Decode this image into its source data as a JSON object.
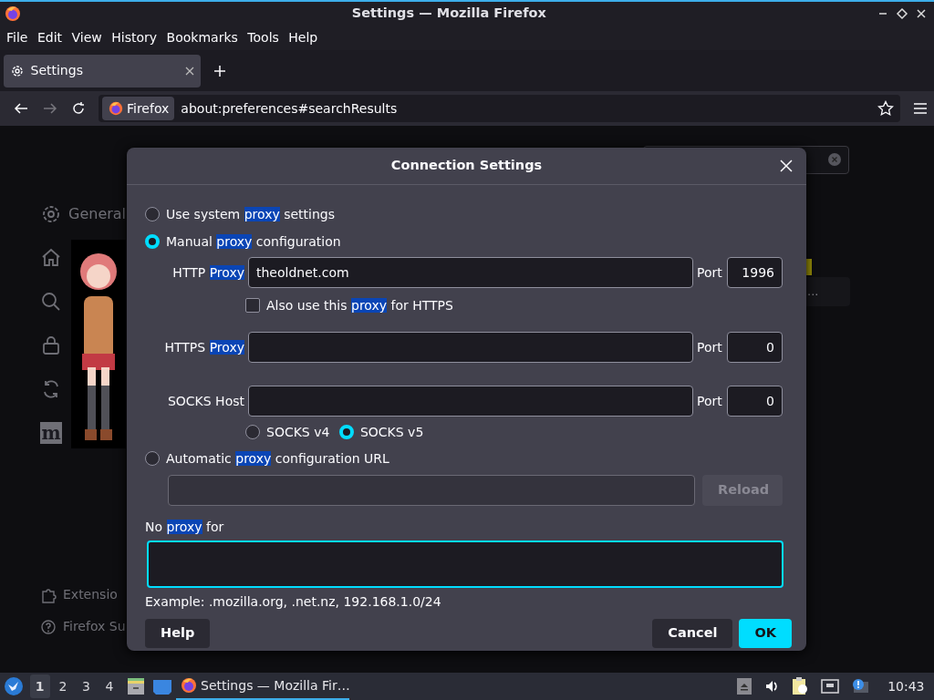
{
  "window": {
    "title": "Settings — Mozilla Firefox"
  },
  "menu_bar": [
    "File",
    "Edit",
    "View",
    "History",
    "Bookmarks",
    "Tools",
    "Help"
  ],
  "tabs": [
    {
      "label": "Settings",
      "selected": true
    }
  ],
  "address_bar": {
    "identity": "Firefox",
    "url": "about:preferences#searchResults"
  },
  "settings_page": {
    "sidebar_label": "General",
    "sidebar_logo_letter": "m",
    "footer": [
      "Extensio",
      "Firefox Su"
    ],
    "result_fragment": "..."
  },
  "dialog": {
    "title": "Connection Settings",
    "modes": [
      {
        "kind": "plain",
        "selected": false,
        "label": [
          {
            "text": "Use system "
          },
          {
            "text": "proxy",
            "highlight": true
          },
          {
            "text": " settings"
          }
        ]
      },
      {
        "kind": "manual",
        "selected": true,
        "label": [
          {
            "text": "Manual "
          },
          {
            "text": "proxy",
            "highlight": true
          },
          {
            "text": " configuration"
          }
        ],
        "proxies": [
          {
            "label": [
              {
                "text": "HTTP "
              },
              {
                "text": "Proxy",
                "highlight": true
              }
            ],
            "value": "theoldnet.com",
            "port_label": "Port",
            "port": "1996"
          },
          {
            "label": [
              {
                "text": "HTTPS "
              },
              {
                "text": "Proxy",
                "highlight": true
              }
            ],
            "port_label": "Port",
            "port": "0"
          },
          {
            "label": [
              {
                "text": "SOCKS Host"
              }
            ],
            "port_label": "Port",
            "port": "0"
          }
        ],
        "also_https": {
          "checked": false,
          "label": [
            {
              "text": "Also use this "
            },
            {
              "text": "proxy",
              "highlight": true
            },
            {
              "text": " for HTTPS"
            }
          ]
        },
        "socks_versions": [
          {
            "label": "SOCKS v4",
            "selected": false
          },
          {
            "label": "SOCKS v5",
            "selected": true
          }
        ]
      },
      {
        "kind": "auto",
        "selected": false,
        "label": [
          {
            "text": "Automatic "
          },
          {
            "text": "proxy",
            "highlight": true
          },
          {
            "text": " configuration URL"
          }
        ],
        "reload": {
          "label": "Reload",
          "disabled": true
        }
      }
    ],
    "no_proxy": {
      "label": [
        {
          "text": "No "
        },
        {
          "text": "proxy",
          "highlight": true
        },
        {
          "text": " for"
        }
      ],
      "focused": true
    },
    "example": "Example: .mozilla.org, .net.nz, 192.168.1.0/24",
    "buttons": [
      {
        "label": "Help",
        "kind": "secondary"
      },
      {
        "label": "Cancel",
        "kind": "secondary"
      },
      {
        "label": "OK",
        "kind": "primary"
      }
    ]
  },
  "taskbar": {
    "workspaces": [
      {
        "label": "1",
        "selected": true
      },
      {
        "label": "2",
        "selected": false
      },
      {
        "label": "3",
        "selected": false
      },
      {
        "label": "4",
        "selected": false
      }
    ],
    "tasks": [
      {
        "label": "Settings — Mozilla Fir…",
        "selected": true
      }
    ],
    "clock": "10:43"
  }
}
